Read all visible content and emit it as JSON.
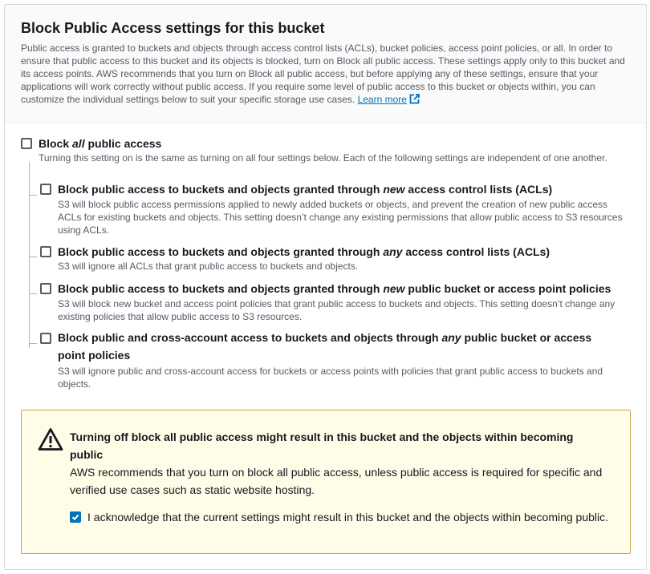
{
  "header": {
    "title": "Block Public Access settings for this bucket",
    "description": "Public access is granted to buckets and objects through access control lists (ACLs), bucket policies, access point policies, or all. In order to ensure that public access to this bucket and its objects is blocked, turn on Block all public access. These settings apply only to this bucket and its access points. AWS recommends that you turn on Block all public access, but before applying any of these settings, ensure that your applications will work correctly without public access. If you require some level of public access to this bucket or objects within, you can customize the individual settings below to suit your specific storage use cases.",
    "learn_more": "Learn more",
    "learn_more_icon": "external-link-icon"
  },
  "block_all": {
    "label_before": "Block ",
    "label_em": "all",
    "label_after": " public access",
    "checked": false,
    "description": "Turning this setting on is the same as turning on all four settings below. Each of the following settings are independent of one another."
  },
  "options": [
    {
      "label_before": "Block public access to buckets and objects granted through ",
      "label_em": "new",
      "label_after": " access control lists (ACLs)",
      "checked": false,
      "description": "S3 will block public access permissions applied to newly added buckets or objects, and prevent the creation of new public access ACLs for existing buckets and objects. This setting doesn’t change any existing permissions that allow public access to S3 resources using ACLs."
    },
    {
      "label_before": "Block public access to buckets and objects granted through ",
      "label_em": "any",
      "label_after": " access control lists (ACLs)",
      "checked": false,
      "description": "S3 will ignore all ACLs that grant public access to buckets and objects."
    },
    {
      "label_before": "Block public access to buckets and objects granted through ",
      "label_em": "new",
      "label_after": " public bucket or access point policies",
      "checked": false,
      "description": "S3 will block new bucket and access point policies that grant public access to buckets and objects. This setting doesn’t change any existing policies that allow public access to S3 resources."
    },
    {
      "label_before": "Block public and cross-account access to buckets and objects through ",
      "label_em": "any",
      "label_after": " public bucket or access point policies",
      "checked": false,
      "description": "S3 will ignore public and cross-account access for buckets or access points with policies that grant public access to buckets and objects."
    }
  ],
  "warning": {
    "icon": "warning-icon",
    "title": "Turning off block all public access might result in this bucket and the objects within becoming public",
    "body": "AWS recommends that you turn on block all public access, unless public access is required for specific and verified use cases such as static website hosting.",
    "acknowledge_label": "I acknowledge that the current settings might result in this bucket and the objects within becoming public.",
    "acknowledge_checked": true
  },
  "colors": {
    "link": "#0073bb",
    "checkbox_checked": "#0073bb",
    "warning_bg": "#fffce8",
    "warning_border": "#c9a54b"
  }
}
